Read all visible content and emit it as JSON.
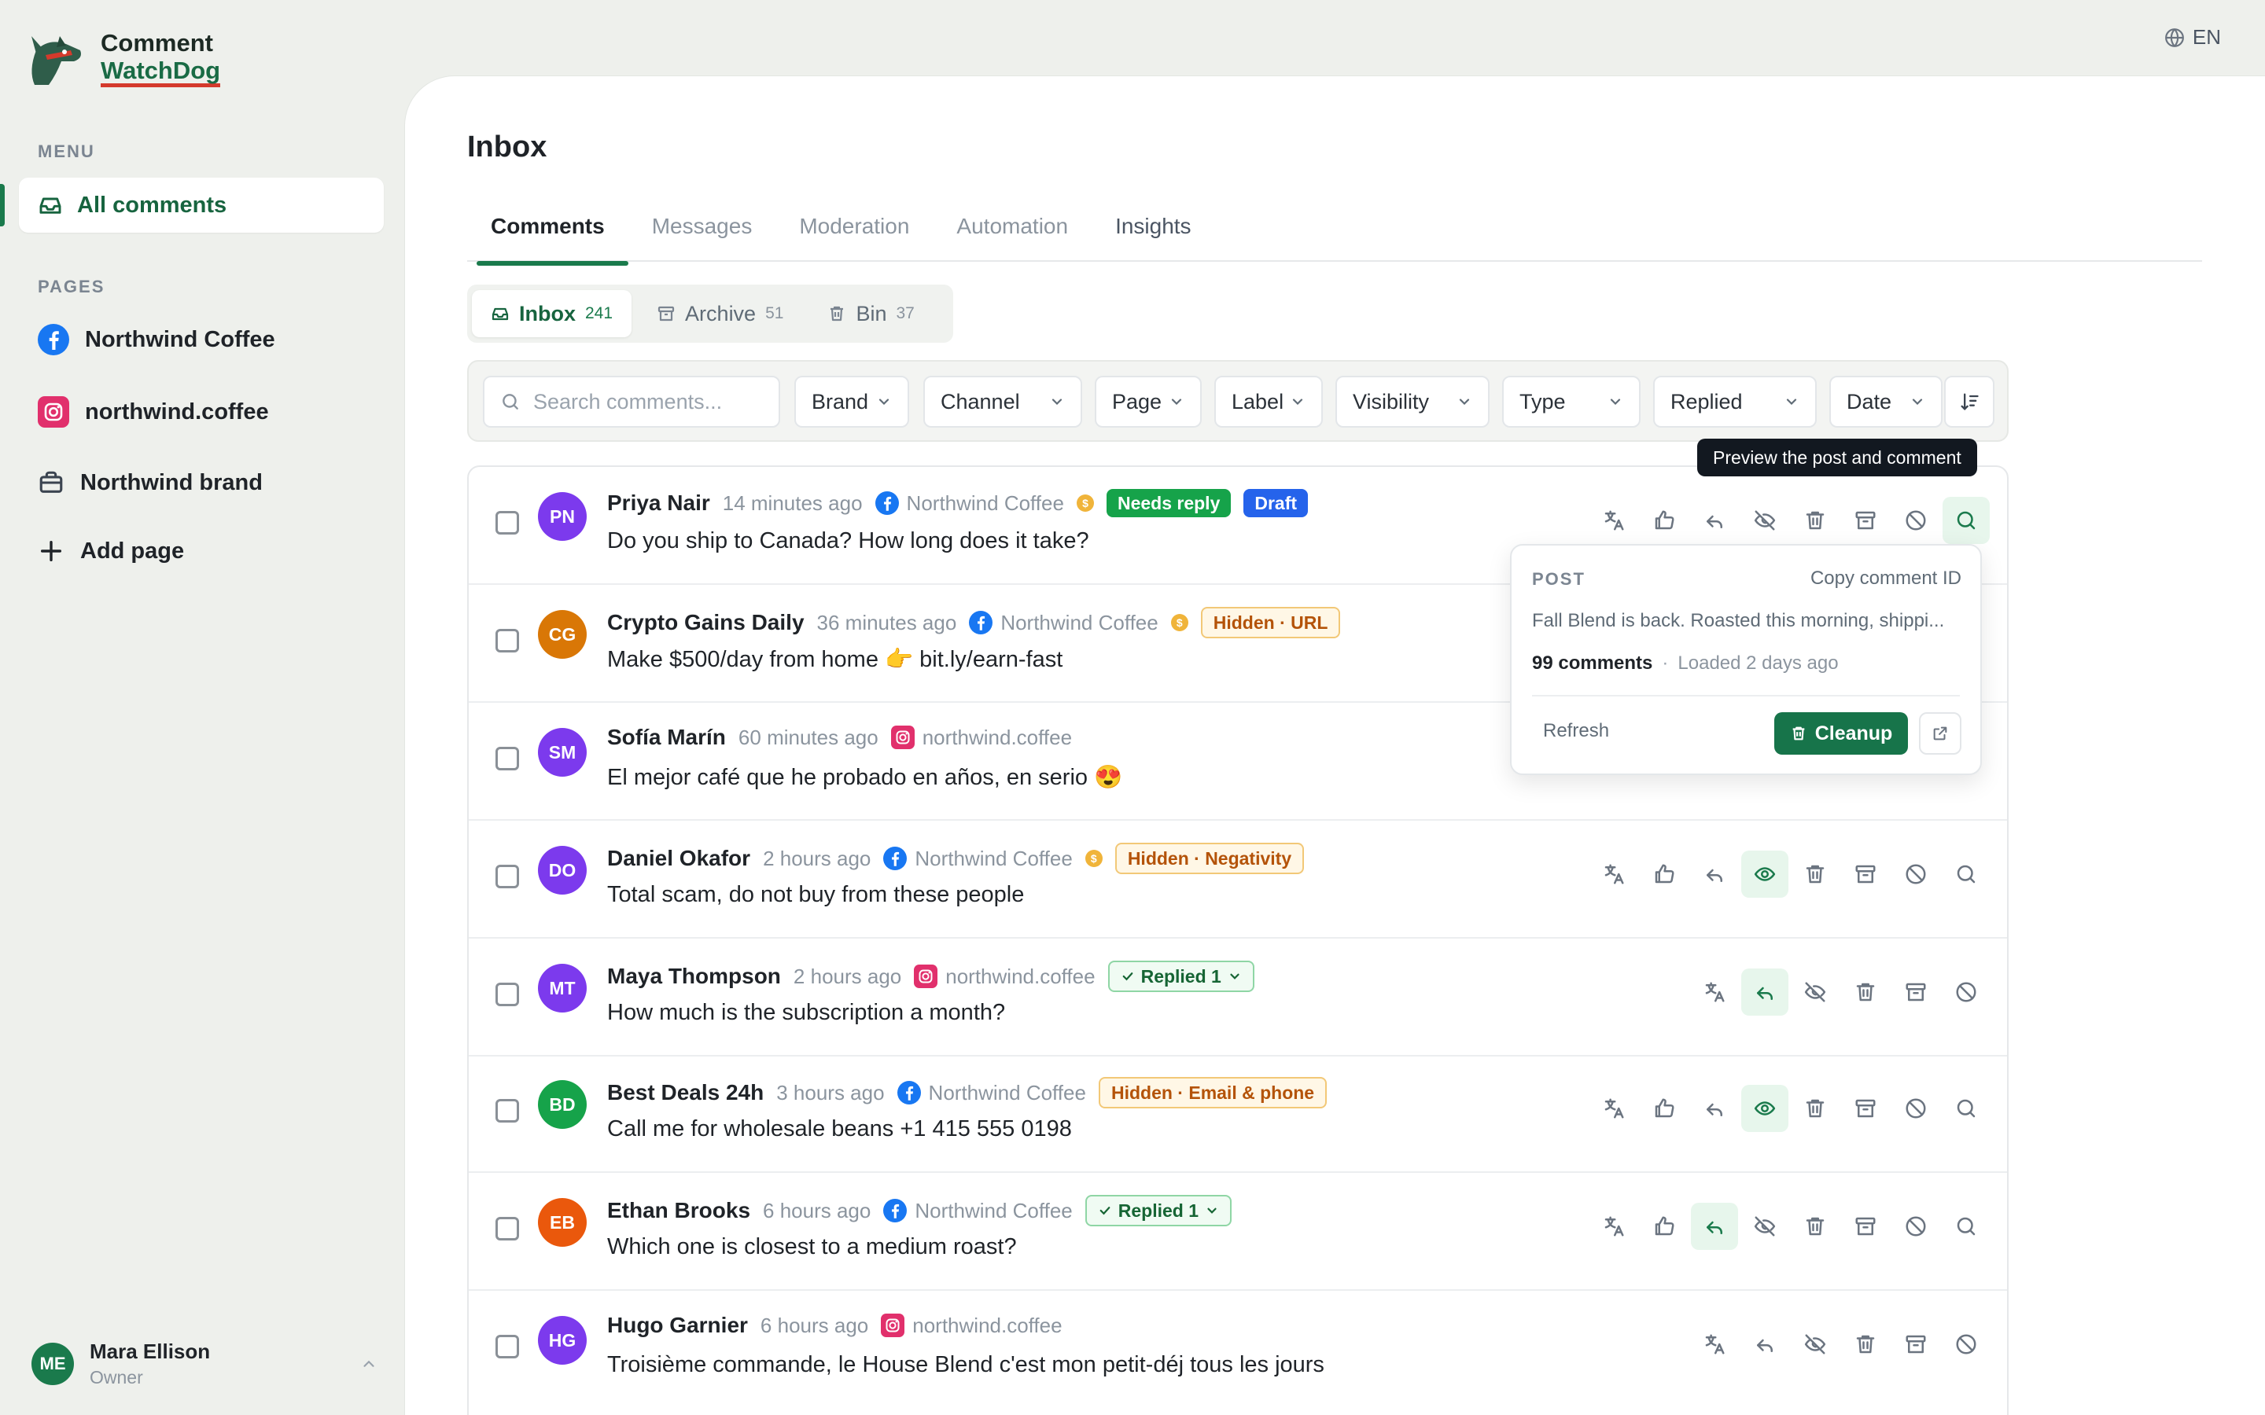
{
  "app": {
    "title_line1": "Comment",
    "title_line2": "WatchDog",
    "language": "EN"
  },
  "sidebar": {
    "menu_label": "MENU",
    "active_item": "All comments",
    "pages_label": "PAGES",
    "pages": [
      {
        "label": "Northwind Coffee",
        "icon": "facebook-icon"
      },
      {
        "label": "northwind.coffee",
        "icon": "instagram-icon"
      },
      {
        "label": "Northwind brand",
        "icon": "briefcase-icon"
      }
    ],
    "add_page": "Add page",
    "user": {
      "initials": "ME",
      "name": "Mara Ellison",
      "role": "Owner"
    }
  },
  "main": {
    "title": "Inbox",
    "tabs": [
      "Comments",
      "Messages",
      "Moderation",
      "Automation",
      "Insights"
    ],
    "segments": [
      {
        "label": "Inbox",
        "count": "241"
      },
      {
        "label": "Archive",
        "count": "51"
      },
      {
        "label": "Bin",
        "count": "37"
      }
    ],
    "search_placeholder": "Search comments...",
    "filters": [
      "Brand",
      "Channel",
      "Page",
      "Label",
      "Visibility",
      "Type",
      "Replied",
      "Date"
    ]
  },
  "tooltip": "Preview the post and comment",
  "popover": {
    "label": "POST",
    "copy_id": "Copy comment ID",
    "post_text": "Fall Blend is back. Roasted this morning, shippi...",
    "comments": "99 comments",
    "separator": "·",
    "loaded": "Loaded 2 days ago",
    "refresh": "Refresh",
    "cleanup": "Cleanup"
  },
  "comments": [
    {
      "initials": "PN",
      "color": "#7c3aed",
      "author": "Priya Nair",
      "time": "14 minutes ago",
      "network": "facebook",
      "page": "Northwind Coffee",
      "coin": true,
      "badges": [
        {
          "text": "Needs reply",
          "kind": "needs"
        },
        {
          "text": "Draft",
          "kind": "draft"
        }
      ],
      "text": "Do you ship to Canada? How long does it take?"
    },
    {
      "initials": "CG",
      "color": "#d97706",
      "author": "Crypto Gains Daily",
      "time": "36 minutes ago",
      "network": "facebook",
      "page": "Northwind Coffee",
      "coin": true,
      "badges": [
        {
          "text": "Hidden · URL",
          "kind": "hidden"
        }
      ],
      "text": "Make $500/day from home 👉 bit.ly/earn-fast"
    },
    {
      "initials": "SM",
      "color": "#7c3aed",
      "author": "Sofía Marín",
      "time": "60 minutes ago",
      "network": "instagram",
      "page": "northwind.coffee",
      "coin": false,
      "badges": [],
      "text": "El mejor café que he probado en años, en serio 😍"
    },
    {
      "initials": "DO",
      "color": "#7c3aed",
      "author": "Daniel Okafor",
      "time": "2 hours ago",
      "network": "facebook",
      "page": "Northwind Coffee",
      "coin": true,
      "badges": [
        {
          "text": "Hidden · Negativity",
          "kind": "hidden"
        }
      ],
      "text": "Total scam, do not buy from these people"
    },
    {
      "initials": "MT",
      "color": "#7c3aed",
      "author": "Maya Thompson",
      "time": "2 hours ago",
      "network": "instagram",
      "page": "northwind.coffee",
      "coin": false,
      "badges": [
        {
          "text": "Replied 1",
          "kind": "replied"
        }
      ],
      "text": "How much is the subscription a month?"
    },
    {
      "initials": "BD",
      "color": "#16a34a",
      "author": "Best Deals 24h",
      "time": "3 hours ago",
      "network": "facebook",
      "page": "Northwind Coffee",
      "coin": false,
      "badges": [
        {
          "text": "Hidden · Email & phone",
          "kind": "hidden"
        }
      ],
      "text": "Call me for wholesale beans +1 415 555 0198"
    },
    {
      "initials": "EB",
      "color": "#ea580c",
      "author": "Ethan Brooks",
      "time": "6 hours ago",
      "network": "facebook",
      "page": "Northwind Coffee",
      "coin": false,
      "badges": [
        {
          "text": "Replied 1",
          "kind": "replied"
        }
      ],
      "text": "Which one is closest to a medium roast?"
    },
    {
      "initials": "HG",
      "color": "#7c3aed",
      "author": "Hugo Garnier",
      "time": "6 hours ago",
      "network": "instagram",
      "page": "northwind.coffee",
      "coin": false,
      "badges": [],
      "text": "Troisième commande, le House Blend c'est mon petit-déj tous les jours"
    }
  ]
}
